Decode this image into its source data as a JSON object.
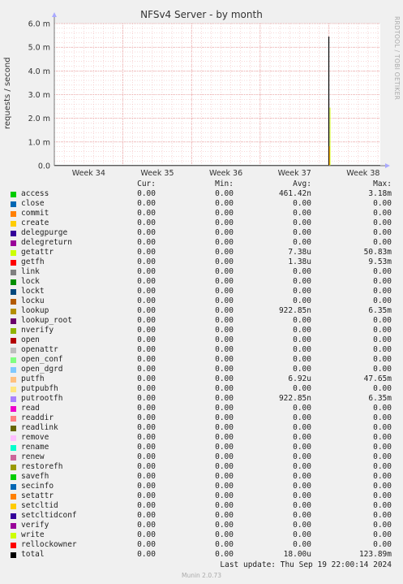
{
  "chart_data": {
    "type": "line",
    "title": "NFSv4 Server - by month",
    "ylabel": "requests / second",
    "side_tag": "RRDTOOL / TOBI OETIKER",
    "y_ticks": [
      "0.0",
      "1.0 m",
      "2.0 m",
      "3.0 m",
      "4.0 m",
      "5.0 m",
      "6.0 m"
    ],
    "ylim": [
      0,
      6.0
    ],
    "y_unit": "m",
    "x_ticks": [
      "Week 34",
      "Week 35",
      "Week 36",
      "Week 37",
      "Week 38"
    ],
    "grid": true,
    "spike": {
      "x_week": 37.5,
      "value_m": 5.45,
      "series": "total"
    },
    "series_colors": {
      "total": "#000000",
      "getattr": "#ccff00",
      "putfh": "#ff8a00"
    }
  },
  "legend": {
    "headers": {
      "cur": "Cur:",
      "min": "Min:",
      "avg": "Avg:",
      "max": "Max:"
    },
    "rows": [
      {
        "name": "access",
        "color": "#00cc00",
        "cur": "0.00",
        "min": "0.00",
        "avg": "461.42n",
        "max": "3.18m"
      },
      {
        "name": "close",
        "color": "#0066b3",
        "cur": "0.00",
        "min": "0.00",
        "avg": "0.00",
        "max": "0.00"
      },
      {
        "name": "commit",
        "color": "#ff8000",
        "cur": "0.00",
        "min": "0.00",
        "avg": "0.00",
        "max": "0.00"
      },
      {
        "name": "create",
        "color": "#ffcc00",
        "cur": "0.00",
        "min": "0.00",
        "avg": "0.00",
        "max": "0.00"
      },
      {
        "name": "delegpurge",
        "color": "#330099",
        "cur": "0.00",
        "min": "0.00",
        "avg": "0.00",
        "max": "0.00"
      },
      {
        "name": "delegreturn",
        "color": "#990099",
        "cur": "0.00",
        "min": "0.00",
        "avg": "0.00",
        "max": "0.00"
      },
      {
        "name": "getattr",
        "color": "#ccff00",
        "cur": "0.00",
        "min": "0.00",
        "avg": "7.38u",
        "max": "50.83m"
      },
      {
        "name": "getfh",
        "color": "#ff0000",
        "cur": "0.00",
        "min": "0.00",
        "avg": "1.38u",
        "max": "9.53m"
      },
      {
        "name": "link",
        "color": "#808080",
        "cur": "0.00",
        "min": "0.00",
        "avg": "0.00",
        "max": "0.00"
      },
      {
        "name": "lock",
        "color": "#008f00",
        "cur": "0.00",
        "min": "0.00",
        "avg": "0.00",
        "max": "0.00"
      },
      {
        "name": "lockt",
        "color": "#00487d",
        "cur": "0.00",
        "min": "0.00",
        "avg": "0.00",
        "max": "0.00"
      },
      {
        "name": "locku",
        "color": "#b35a00",
        "cur": "0.00",
        "min": "0.00",
        "avg": "0.00",
        "max": "0.00"
      },
      {
        "name": "lookup",
        "color": "#b38f00",
        "cur": "0.00",
        "min": "0.00",
        "avg": "922.85n",
        "max": "6.35m"
      },
      {
        "name": "lookup_root",
        "color": "#6b006b",
        "cur": "0.00",
        "min": "0.00",
        "avg": "0.00",
        "max": "0.00"
      },
      {
        "name": "nverify",
        "color": "#8fb300",
        "cur": "0.00",
        "min": "0.00",
        "avg": "0.00",
        "max": "0.00"
      },
      {
        "name": "open",
        "color": "#b30000",
        "cur": "0.00",
        "min": "0.00",
        "avg": "0.00",
        "max": "0.00"
      },
      {
        "name": "openattr",
        "color": "#bebebe",
        "cur": "0.00",
        "min": "0.00",
        "avg": "0.00",
        "max": "0.00"
      },
      {
        "name": "open_conf",
        "color": "#80ff80",
        "cur": "0.00",
        "min": "0.00",
        "avg": "0.00",
        "max": "0.00"
      },
      {
        "name": "open_dgrd",
        "color": "#80c9ff",
        "cur": "0.00",
        "min": "0.00",
        "avg": "0.00",
        "max": "0.00"
      },
      {
        "name": "putfh",
        "color": "#ffc080",
        "cur": "0.00",
        "min": "0.00",
        "avg": "6.92u",
        "max": "47.65m"
      },
      {
        "name": "putpubfh",
        "color": "#ffe680",
        "cur": "0.00",
        "min": "0.00",
        "avg": "0.00",
        "max": "0.00"
      },
      {
        "name": "putrootfh",
        "color": "#aa80ff",
        "cur": "0.00",
        "min": "0.00",
        "avg": "922.85n",
        "max": "6.35m"
      },
      {
        "name": "read",
        "color": "#ee00cc",
        "cur": "0.00",
        "min": "0.00",
        "avg": "0.00",
        "max": "0.00"
      },
      {
        "name": "readdir",
        "color": "#ff8080",
        "cur": "0.00",
        "min": "0.00",
        "avg": "0.00",
        "max": "0.00"
      },
      {
        "name": "readlink",
        "color": "#666600",
        "cur": "0.00",
        "min": "0.00",
        "avg": "0.00",
        "max": "0.00"
      },
      {
        "name": "remove",
        "color": "#ffbfff",
        "cur": "0.00",
        "min": "0.00",
        "avg": "0.00",
        "max": "0.00"
      },
      {
        "name": "rename",
        "color": "#00ffcc",
        "cur": "0.00",
        "min": "0.00",
        "avg": "0.00",
        "max": "0.00"
      },
      {
        "name": "renew",
        "color": "#cc6699",
        "cur": "0.00",
        "min": "0.00",
        "avg": "0.00",
        "max": "0.00"
      },
      {
        "name": "restorefh",
        "color": "#999900",
        "cur": "0.00",
        "min": "0.00",
        "avg": "0.00",
        "max": "0.00"
      },
      {
        "name": "savefh",
        "color": "#00cc00",
        "cur": "0.00",
        "min": "0.00",
        "avg": "0.00",
        "max": "0.00"
      },
      {
        "name": "secinfo",
        "color": "#0066b3",
        "cur": "0.00",
        "min": "0.00",
        "avg": "0.00",
        "max": "0.00"
      },
      {
        "name": "setattr",
        "color": "#ff8000",
        "cur": "0.00",
        "min": "0.00",
        "avg": "0.00",
        "max": "0.00"
      },
      {
        "name": "setcltid",
        "color": "#ffcc00",
        "cur": "0.00",
        "min": "0.00",
        "avg": "0.00",
        "max": "0.00"
      },
      {
        "name": "setcltidconf",
        "color": "#330099",
        "cur": "0.00",
        "min": "0.00",
        "avg": "0.00",
        "max": "0.00"
      },
      {
        "name": "verify",
        "color": "#990099",
        "cur": "0.00",
        "min": "0.00",
        "avg": "0.00",
        "max": "0.00"
      },
      {
        "name": "write",
        "color": "#ccff00",
        "cur": "0.00",
        "min": "0.00",
        "avg": "0.00",
        "max": "0.00"
      },
      {
        "name": "rellockowner",
        "color": "#ff0000",
        "cur": "0.00",
        "min": "0.00",
        "avg": "0.00",
        "max": "0.00"
      },
      {
        "name": "total",
        "color": "#000000",
        "cur": "0.00",
        "min": "0.00",
        "avg": "18.00u",
        "max": "123.89m"
      }
    ]
  },
  "footer": {
    "last_update": "Last update: Thu Sep 19 22:00:14 2024",
    "version": "Munin 2.0.73"
  }
}
